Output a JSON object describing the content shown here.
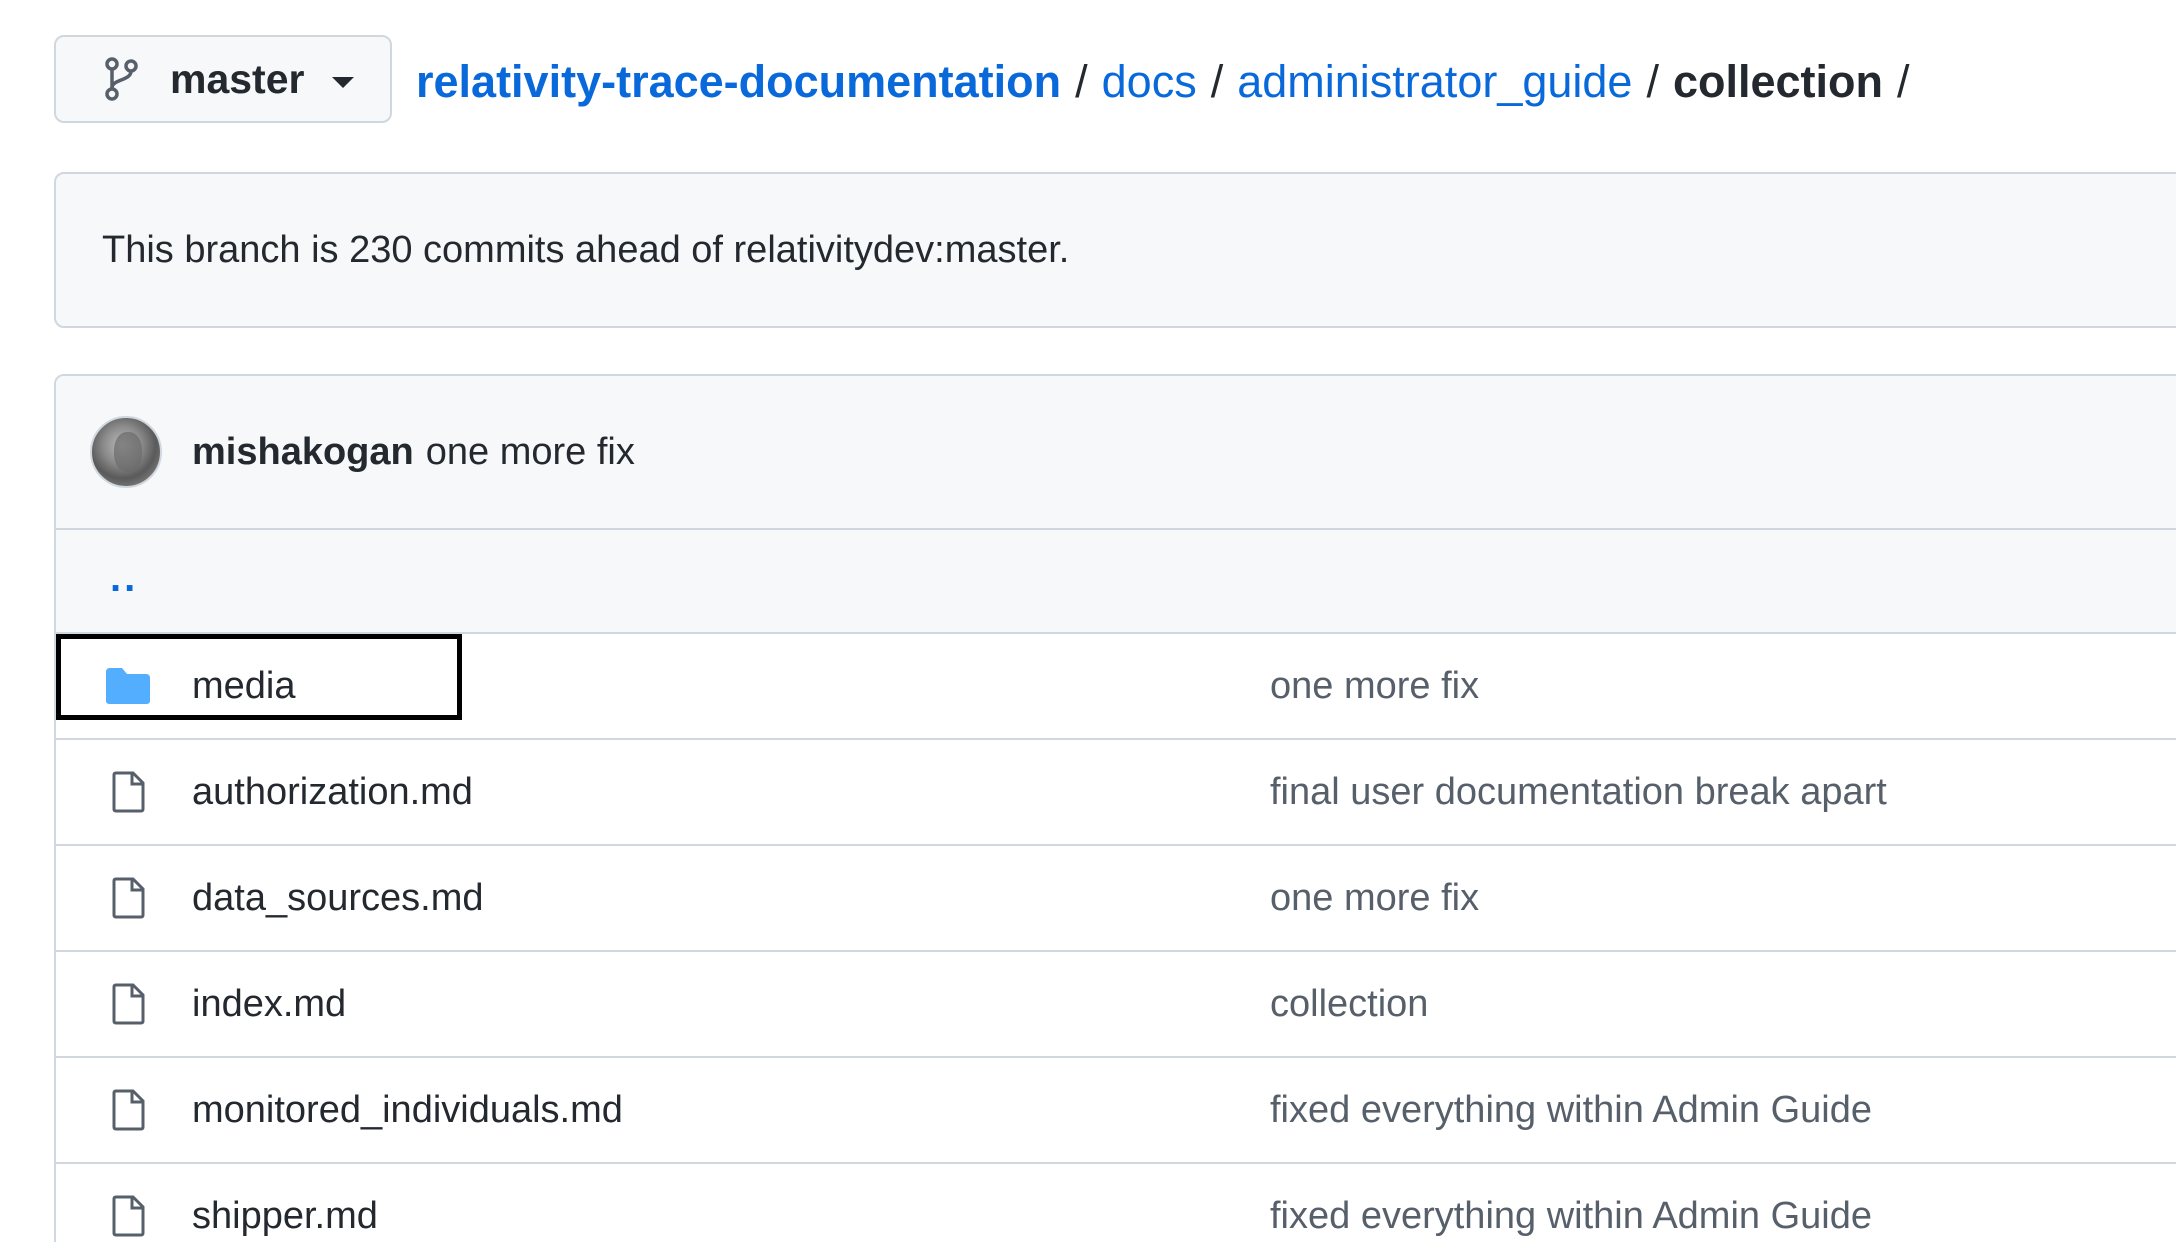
{
  "branch": {
    "name": "master"
  },
  "breadcrumb": {
    "repo": "relativity-trace-documentation",
    "parts": [
      "docs",
      "administrator_guide"
    ],
    "current": "collection",
    "separator": "/"
  },
  "notice": {
    "text": "This branch is 230 commits ahead of relativitydev:master."
  },
  "latest_commit": {
    "author": "mishakogan",
    "message": "one more fix"
  },
  "parent_dir": {
    "label": ".."
  },
  "files": [
    {
      "name": "media",
      "type": "folder",
      "message": "one more fix",
      "highlighted": true
    },
    {
      "name": "authorization.md",
      "type": "file",
      "message": "final user documentation break apart"
    },
    {
      "name": "data_sources.md",
      "type": "file",
      "message": "one more fix"
    },
    {
      "name": "index.md",
      "type": "file",
      "message": "collection"
    },
    {
      "name": "monitored_individuals.md",
      "type": "file",
      "message": "fixed everything within Admin Guide"
    },
    {
      "name": "shipper.md",
      "type": "file",
      "message": "fixed everything within Admin Guide"
    }
  ],
  "icons": {
    "branch": "git-branch-icon",
    "caret": "caret-down-icon",
    "folder": "folder-icon",
    "file": "file-icon"
  },
  "colors": {
    "link": "#0969da",
    "folder": "#54aeff",
    "border": "#d0d7de",
    "muted_text": "#57606a",
    "highlight": "#000000"
  }
}
